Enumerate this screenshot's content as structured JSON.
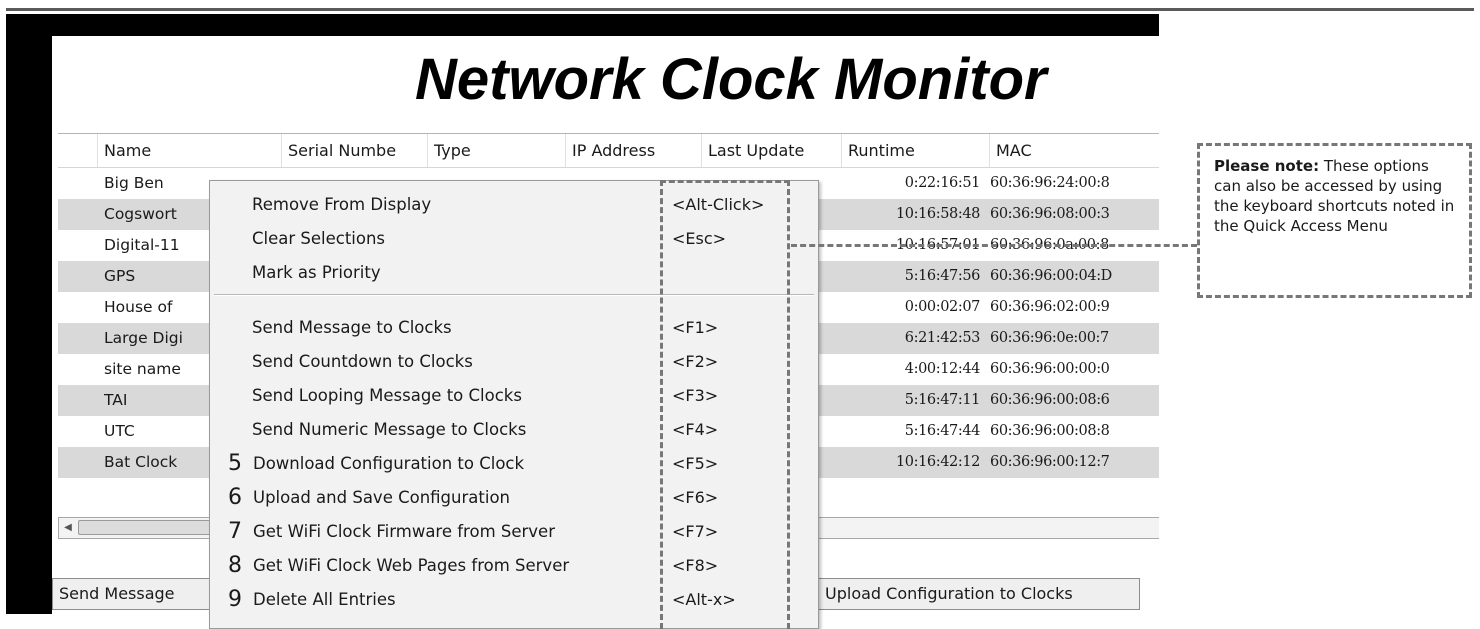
{
  "app": {
    "title": "Network Clock Monitor"
  },
  "grid": {
    "columns": [
      "Name",
      "Serial Numbe",
      "Type",
      "IP Address",
      "Last Update",
      "Runtime",
      "MAC"
    ],
    "rows": [
      {
        "name": "Big Ben",
        "runtime": "0:22:16:51",
        "mac": "60:36:96:24:00:8"
      },
      {
        "name": "Cogswort",
        "runtime": "10:16:58:48",
        "mac": "60:36:96:08:00:3"
      },
      {
        "name": "Digital-11",
        "runtime": "10:16:57:01",
        "mac": "60:36:96:0a:00:8"
      },
      {
        "name": "GPS",
        "runtime": "5:16:47:56",
        "mac": "60:36:96:00:04:D"
      },
      {
        "name": "House of",
        "runtime": "0:00:02:07",
        "mac": "60:36:96:02:00:9"
      },
      {
        "name": "Large Digi",
        "runtime": "6:21:42:53",
        "mac": "60:36:96:0e:00:7"
      },
      {
        "name": "site name",
        "runtime": "4:00:12:44",
        "mac": "60:36:96:00:00:0"
      },
      {
        "name": "TAI",
        "runtime": "5:16:47:11",
        "mac": "60:36:96:00:08:6"
      },
      {
        "name": "UTC",
        "runtime": "5:16:47:44",
        "mac": "60:36:96:00:08:8"
      },
      {
        "name": "Bat Clock",
        "runtime": "10:16:42:12",
        "mac": "60:36:96:00:12:7"
      }
    ]
  },
  "buttons": {
    "send_message": "Send Message",
    "upload_config": "Upload Configuration to Clocks"
  },
  "context_menu": {
    "items": [
      {
        "num": "",
        "label": "Remove From Display",
        "shortcut": "<Alt-Click>"
      },
      {
        "num": "",
        "label": "Clear Selections",
        "shortcut": "<Esc>"
      },
      {
        "num": "",
        "label": "Mark as Priority",
        "shortcut": ""
      },
      {
        "num": "",
        "label": "Send Message to Clocks",
        "shortcut": "<F1>"
      },
      {
        "num": "",
        "label": "Send Countdown to Clocks",
        "shortcut": "<F2>"
      },
      {
        "num": "",
        "label": "Send Looping Message to Clocks",
        "shortcut": "<F3>"
      },
      {
        "num": "",
        "label": "Send Numeric Message to Clocks",
        "shortcut": "<F4>"
      },
      {
        "num": "5",
        "label": "Download Configuration to Clock",
        "shortcut": "<F5>"
      },
      {
        "num": "6",
        "label": "Upload and Save Configuration",
        "shortcut": "<F6>"
      },
      {
        "num": "7",
        "label": "Get WiFi Clock Firmware from Server",
        "shortcut": "<F7>"
      },
      {
        "num": "8",
        "label": "Get WiFi Clock Web Pages from Server",
        "shortcut": "<F8>"
      },
      {
        "num": "9",
        "label": "Delete All Entries",
        "shortcut": "<Alt-x>"
      }
    ]
  },
  "note": {
    "bold": "Please note:",
    "text": " These options can also be accessed by using the keyboard shortcuts noted in the Quick Access Menu"
  },
  "icons": {
    "scroll_left": "scroll-left-arrow-icon"
  }
}
